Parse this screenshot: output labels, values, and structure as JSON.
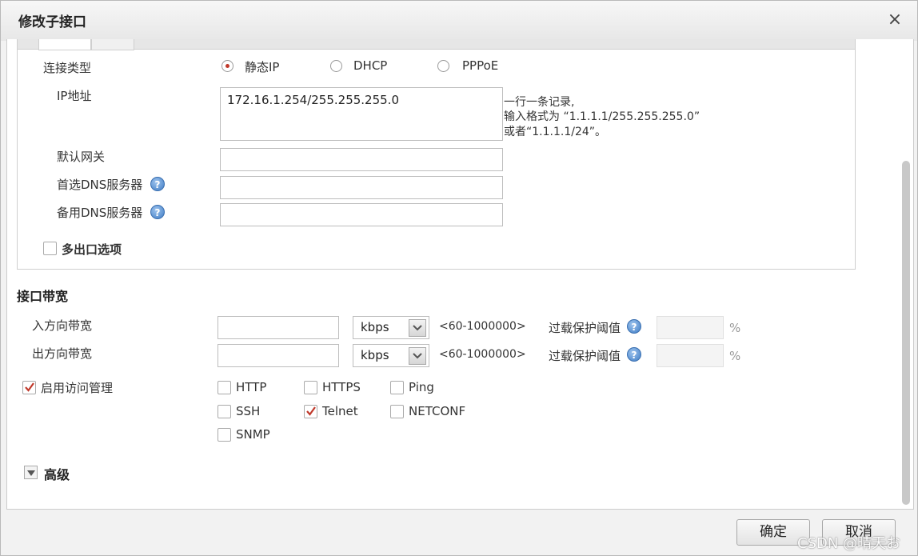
{
  "dialog": {
    "title": "修改子接口",
    "close_glyph": "×"
  },
  "connection": {
    "label": "连接类型",
    "options": [
      {
        "label": "静态IP",
        "selected": true
      },
      {
        "label": "DHCP",
        "selected": false
      },
      {
        "label": "PPPoE",
        "selected": false
      }
    ]
  },
  "ip": {
    "label": "IP地址",
    "value": "172.16.1.254/255.255.255.0",
    "hint_line1": "一行一条记录,",
    "hint_line2": "输入格式为 “1.1.1.1/255.255.255.0”",
    "hint_line3": "或者“1.1.1.1/24”。"
  },
  "gateway": {
    "label": "默认网关",
    "value": ""
  },
  "dns_primary": {
    "label": "首选DNS服务器",
    "value": ""
  },
  "dns_secondary": {
    "label": "备用DNS服务器",
    "value": ""
  },
  "multi_exit": {
    "label": "多出口选项",
    "checked": false
  },
  "bandwidth": {
    "section_title": "接口带宽",
    "inbound": {
      "label": "入方向带宽",
      "value": "",
      "unit": "kbps",
      "range": "<60-1000000>",
      "threshold_label": "过载保护阈值",
      "percent": "%"
    },
    "outbound": {
      "label": "出方向带宽",
      "value": "",
      "unit": "kbps",
      "range": "<60-1000000>",
      "threshold_label": "过载保护阈值",
      "percent": "%"
    }
  },
  "access_mgmt": {
    "label": "启用访问管理",
    "checked": true,
    "protocols": [
      {
        "label": "HTTP",
        "checked": false
      },
      {
        "label": "HTTPS",
        "checked": false
      },
      {
        "label": "Ping",
        "checked": false
      },
      {
        "label": "SSH",
        "checked": false
      },
      {
        "label": "Telnet",
        "checked": true
      },
      {
        "label": "NETCONF",
        "checked": false
      },
      {
        "label": "SNMP",
        "checked": false
      }
    ]
  },
  "advanced": {
    "label": "高级"
  },
  "footer": {
    "ok_label": "确定",
    "cancel_label": "取消"
  },
  "watermark": "CSDN @晴天お",
  "colors": {
    "accent": "#c0392b",
    "help": "#3f7cc5"
  }
}
